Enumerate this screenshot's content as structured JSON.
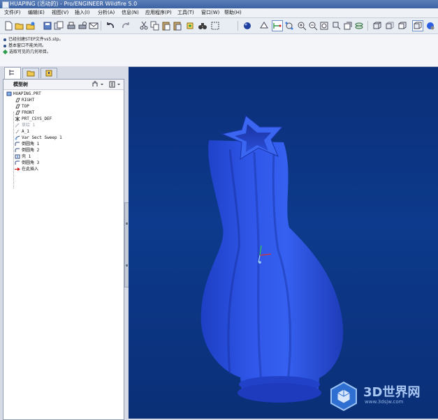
{
  "window": {
    "title": "HUAPING (活动的) - Pro/ENGINEER Wildfire 5.0"
  },
  "menu": [
    {
      "label": "文件(F)"
    },
    {
      "label": "编辑(E)"
    },
    {
      "label": "视图(V)"
    },
    {
      "label": "插入(I)"
    },
    {
      "label": "分析(A)"
    },
    {
      "label": "信息(N)"
    },
    {
      "label": "应用程序(P)"
    },
    {
      "label": "工具(T)"
    },
    {
      "label": "窗口(W)"
    },
    {
      "label": "帮助(H)"
    }
  ],
  "toolbar": {
    "icons": [
      "new-file-icon",
      "open-file-icon",
      "open-session-icon",
      "save-icon",
      "save-copy-icon",
      "print-icon",
      "print-preview-icon",
      "email-icon",
      "undo-icon",
      "redo-icon",
      "cut-icon",
      "copy-icon",
      "paste-icon",
      "paste-special-icon",
      "regenerate-icon",
      "find-icon",
      "select-box-icon",
      "shading-sphere-icon",
      "layer-icon",
      "datum-display-icon",
      "spin-center-icon",
      "zoom-in-icon",
      "zoom-out-icon",
      "refit-icon",
      "reorient-icon",
      "saved-views-icon",
      "wireframe-icon",
      "hidden-line-icon",
      "no-hidden-icon",
      "shading-icon",
      "enhanced-realism-icon"
    ]
  },
  "messages": [
    {
      "icon": "info-bullet",
      "text": "已经创建STEP文件vs5.stp。"
    },
    {
      "icon": "info-bullet",
      "text": "基本窗口不能关闭。"
    },
    {
      "icon": "select-diamond",
      "text": "选取可见的几何项目。"
    }
  ],
  "navigator": {
    "tabs": [
      "model-tree-tab-icon",
      "folder-browser-tab-icon",
      "favorites-tab-icon"
    ],
    "tree_title": "模型树",
    "items": [
      {
        "label": "HUAPING.PRT",
        "icon": "part-icon",
        "suppressed": false
      },
      {
        "label": "RIGHT",
        "icon": "datum-plane-icon",
        "suppressed": false
      },
      {
        "label": "TOP",
        "icon": "datum-plane-icon",
        "suppressed": false
      },
      {
        "label": "FRONT",
        "icon": "datum-plane-icon",
        "suppressed": false
      },
      {
        "label": "PRT_CSYS_DEF",
        "icon": "csys-icon",
        "suppressed": false
      },
      {
        "label": "草绘 1",
        "icon": "sketch-icon",
        "suppressed": true
      },
      {
        "label": "A_1",
        "icon": "axis-icon",
        "suppressed": false
      },
      {
        "label": "Var Sect Sweep 1",
        "icon": "sweep-icon",
        "suppressed": false
      },
      {
        "label": "倒圆角 1",
        "icon": "round-icon",
        "suppressed": false
      },
      {
        "label": "倒圆角 2",
        "icon": "round-icon",
        "suppressed": false
      },
      {
        "label": "壳 1",
        "icon": "shell-icon",
        "suppressed": false
      },
      {
        "label": "倒圆角 3",
        "icon": "round-icon",
        "suppressed": false
      },
      {
        "label": "在此插入",
        "icon": "insert-here-icon",
        "suppressed": false
      }
    ]
  },
  "watermark": {
    "text": "3D世界网",
    "url": "www.3dsjw.com"
  },
  "colors": {
    "viewport_top": "#0b2f78",
    "model_blue": "#2f56e8",
    "insert_arrow": "#d01818"
  }
}
